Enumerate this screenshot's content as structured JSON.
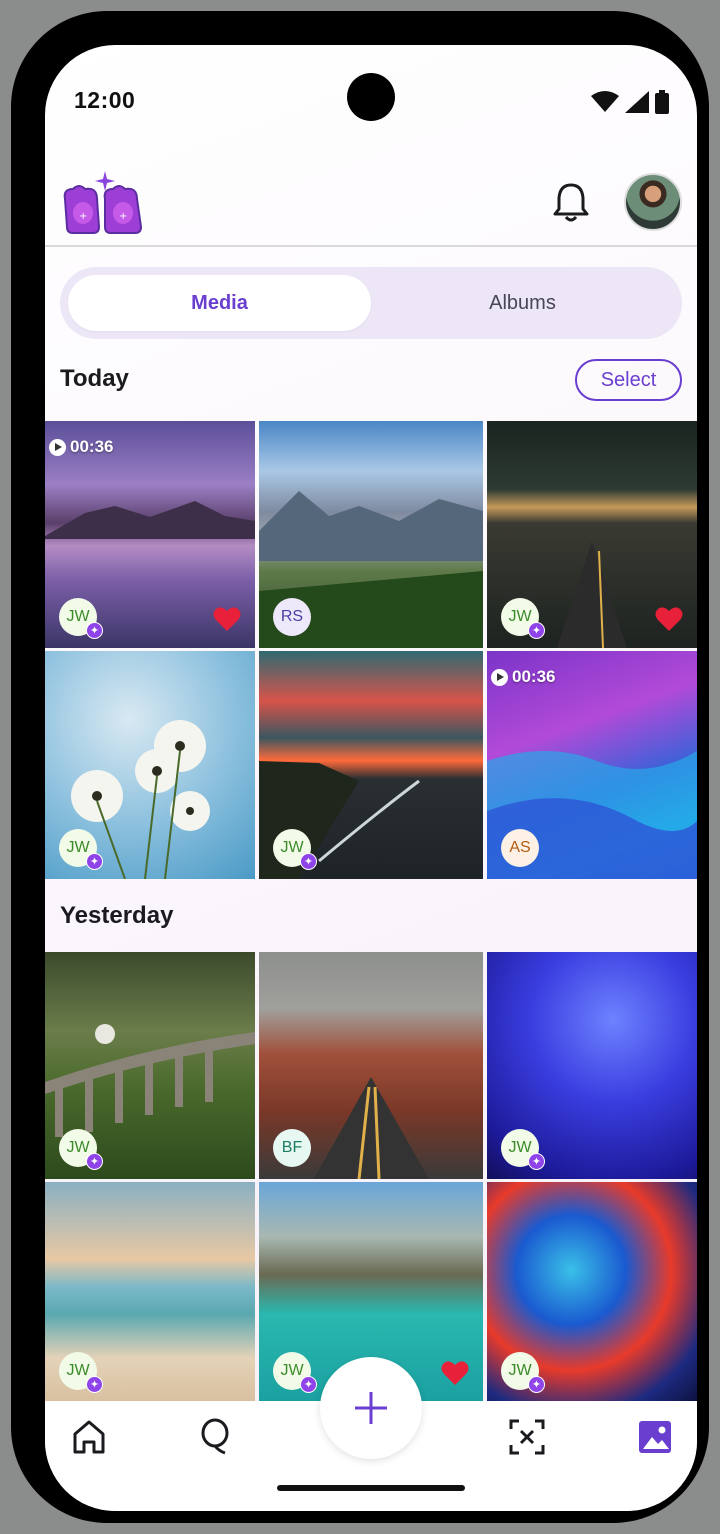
{
  "status_bar": {
    "time": "12:00"
  },
  "header": {
    "logo": "toast-logo-icon",
    "bell": "bell-icon",
    "avatar": "profile-avatar"
  },
  "tabs": [
    {
      "label": "Media",
      "selected": true
    },
    {
      "label": "Albums",
      "selected": false
    }
  ],
  "sections": [
    {
      "title": "Today",
      "action_label": "Select",
      "items": [
        {
          "kind": "video",
          "duration": "00:36",
          "owner": "JW",
          "shared": true,
          "favorite": true,
          "scene": "lake-mountains-dusk"
        },
        {
          "kind": "photo",
          "owner": "RS",
          "shared": false,
          "favorite": false,
          "scene": "mountain-valley"
        },
        {
          "kind": "photo",
          "owner": "JW",
          "shared": true,
          "favorite": true,
          "scene": "city-street-sunset"
        },
        {
          "kind": "photo",
          "owner": "JW",
          "shared": true,
          "favorite": false,
          "scene": "white-flowers-sky"
        },
        {
          "kind": "photo",
          "owner": "JW",
          "shared": true,
          "favorite": false,
          "scene": "red-sunset-lake"
        },
        {
          "kind": "video",
          "duration": "00:36",
          "owner": "AS",
          "shared": false,
          "favorite": false,
          "scene": "purple-blue-waves"
        }
      ]
    },
    {
      "title": "Yesterday",
      "items": [
        {
          "kind": "photo",
          "owner": "JW",
          "shared": true,
          "favorite": false,
          "scene": "train-viaduct"
        },
        {
          "kind": "photo",
          "owner": "BF",
          "shared": false,
          "favorite": false,
          "scene": "desert-road"
        },
        {
          "kind": "photo",
          "owner": "JW",
          "shared": true,
          "favorite": false,
          "scene": "blue-abstract"
        },
        {
          "kind": "photo",
          "owner": "JW",
          "shared": true,
          "favorite": false,
          "scene": "beach-sunset"
        },
        {
          "kind": "photo",
          "owner": "JW",
          "shared": true,
          "favorite": true,
          "scene": "lake-boats-mountains"
        },
        {
          "kind": "photo",
          "owner": "JW",
          "shared": true,
          "favorite": false,
          "scene": "colorful-ink"
        }
      ]
    }
  ],
  "bottom_nav": [
    {
      "icon": "home-icon",
      "active": false
    },
    {
      "icon": "balloon-icon",
      "active": false
    },
    {
      "icon": "add-icon",
      "active": false
    },
    {
      "icon": "scan-icon",
      "active": false
    },
    {
      "icon": "gallery-icon",
      "active": true
    }
  ],
  "colors": {
    "accent": "#6a3fd0",
    "heart": "#e8203a",
    "shared_badge": "#8e44e8"
  }
}
